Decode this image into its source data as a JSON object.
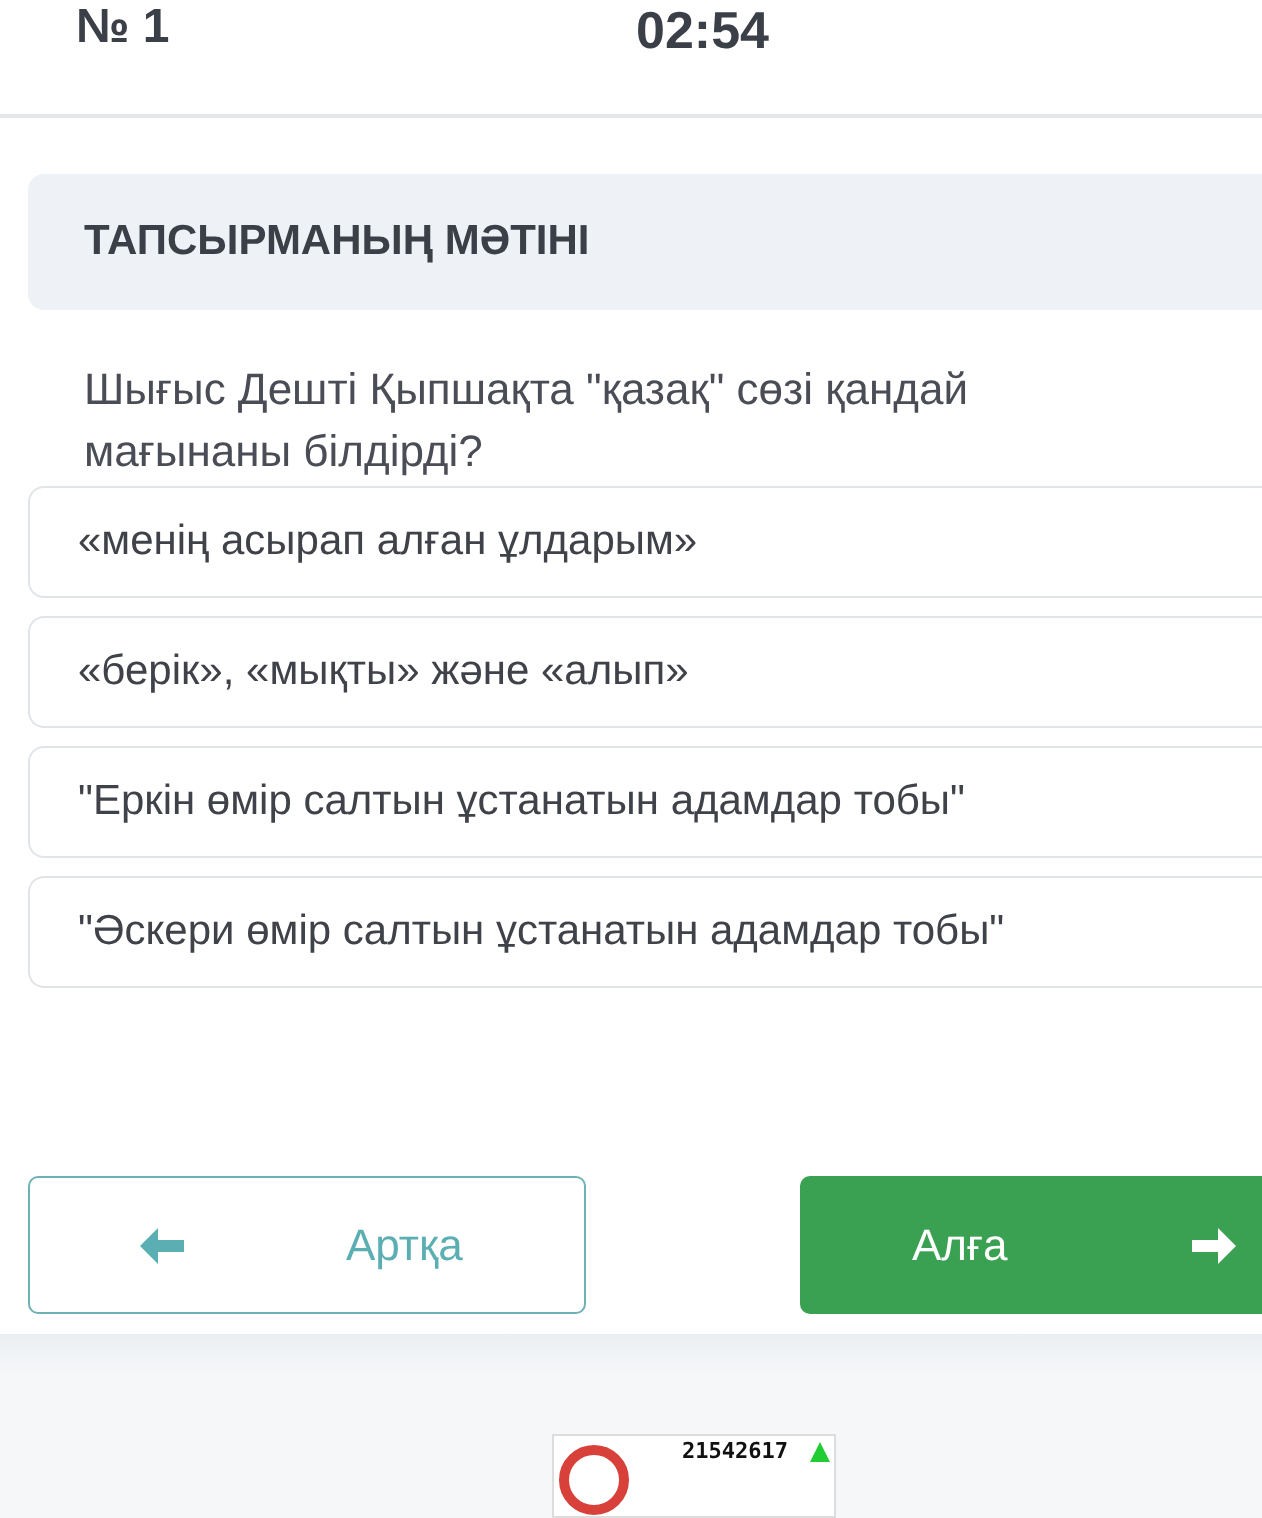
{
  "header": {
    "number": "№ 1",
    "timer": "02:54"
  },
  "task": {
    "title": "ТАПСЫРМАНЫҢ МӘТІНІ",
    "question": "Шығыс Дешті Қыпшақта \"қазақ\" сөзі қандай мағынаны білдірді?"
  },
  "options": [
    {
      "label": "«менің асырап алған ұлдарым»",
      "selected": false
    },
    {
      "label": "«берік», «мықты» және «алып»",
      "selected": false
    },
    {
      "label": "\"Еркін өмір салтын ұстанатын адамдар тобы\"",
      "selected": false
    },
    {
      "label": "\"Әскери өмір салтын ұстанатын адамдар тобы\"",
      "selected": false
    }
  ],
  "buttons": {
    "back": "Артқа",
    "next": "Алға"
  },
  "counter": {
    "value": "21542617"
  }
}
